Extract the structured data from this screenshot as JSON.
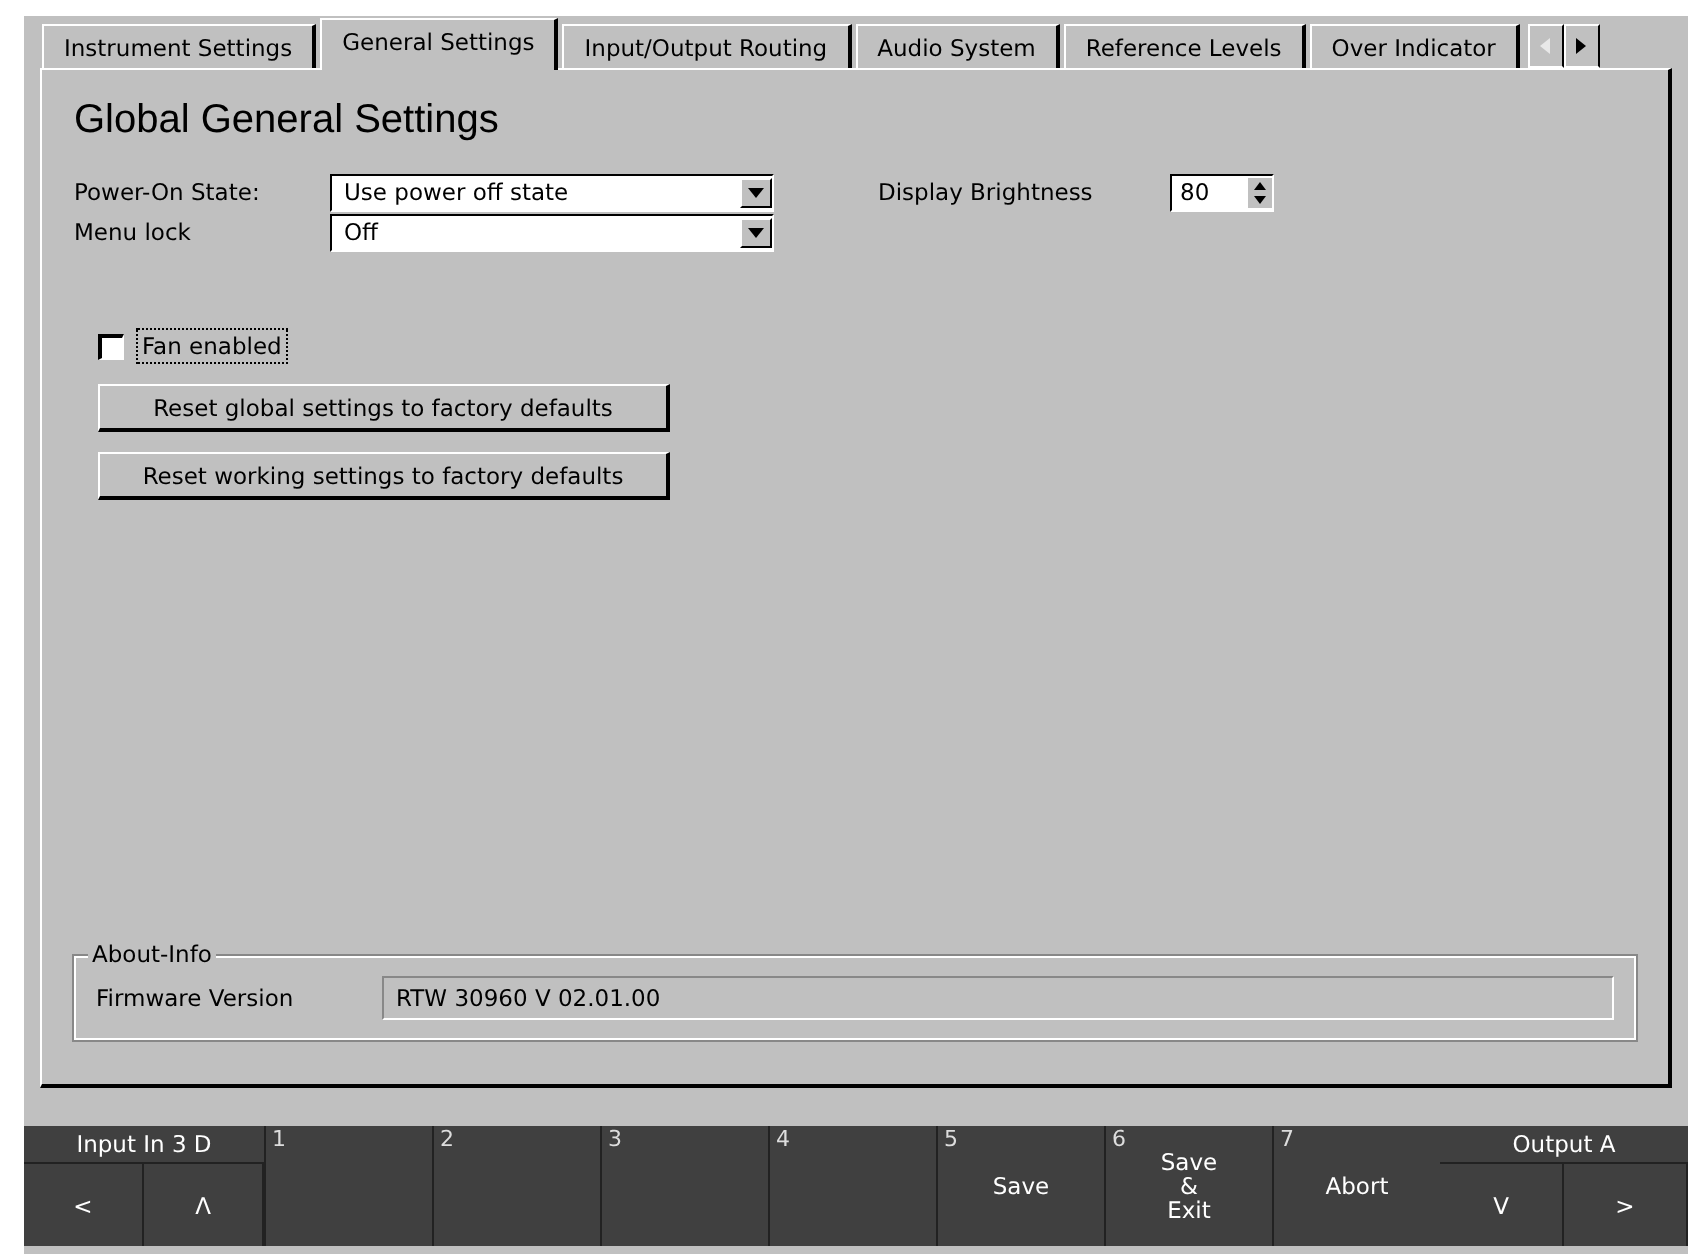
{
  "tabs": [
    {
      "label": "Instrument Settings",
      "selected": false
    },
    {
      "label": "General Settings",
      "selected": true
    },
    {
      "label": "Input/Output Routing",
      "selected": false
    },
    {
      "label": "Audio System",
      "selected": false
    },
    {
      "label": "Reference Levels",
      "selected": false
    },
    {
      "label": "Over Indicator",
      "selected": false
    }
  ],
  "tab_scroll": {
    "left_disabled": true,
    "right_disabled": false
  },
  "heading": "Global General Settings",
  "power_on_state": {
    "label": "Power-On State:",
    "value": "Use power off state"
  },
  "menu_lock": {
    "label": "Menu lock",
    "value": "Off"
  },
  "display_brightness": {
    "label": "Display Brightness",
    "value": "80"
  },
  "fan_enabled": {
    "label": "Fan enabled",
    "checked": false
  },
  "buttons": [
    "Reset global settings to factory defaults",
    "Reset working settings to factory defaults"
  ],
  "about": {
    "title": "About-Info",
    "label": "Firmware Version",
    "value": "RTW 30960 V 02.01.00"
  },
  "softkeys": {
    "left": {
      "title": "Input In 3 D",
      "keys": [
        "<",
        "Λ"
      ]
    },
    "numbered": [
      {
        "number": "1"
      },
      {
        "number": "2"
      },
      {
        "number": "3"
      },
      {
        "number": "4"
      },
      {
        "number": "5",
        "label": "Save"
      },
      {
        "number": "6",
        "label": "Save\n&\nExit"
      },
      {
        "number": "7",
        "label": "Abort"
      }
    ],
    "right": {
      "title": "Output A",
      "keys": [
        "V",
        ">"
      ]
    }
  }
}
